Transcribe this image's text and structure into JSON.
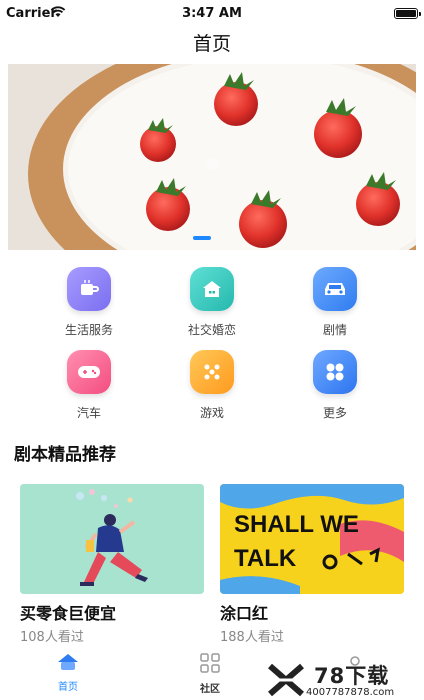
{
  "status": {
    "carrier": "Carrier",
    "time": "3:47 AM"
  },
  "nav": {
    "title": "首页"
  },
  "banner": {
    "image": "strawberry-toast-photo"
  },
  "grid": [
    {
      "label": "生活服务",
      "icon": "cup-icon",
      "color": "#8f86f5"
    },
    {
      "label": "社交婚恋",
      "icon": "house-icon",
      "color": "#3ccfc4"
    },
    {
      "label": "剧情",
      "icon": "car-icon",
      "color": "#4a93ff"
    },
    {
      "label": "汽车",
      "icon": "gamepad-icon",
      "color": "#ff6f98"
    },
    {
      "label": "游戏",
      "icon": "dots-icon",
      "color": "#ffb02e"
    },
    {
      "label": "更多",
      "icon": "more-icon",
      "color": "#3f8dff"
    }
  ],
  "section": {
    "title": "剧本精品推荐"
  },
  "cards": [
    {
      "title": "买零食巨便宜",
      "views": "108人看过"
    },
    {
      "title": "涂口红",
      "views": "188人看过",
      "art_text": "SHALL WE TALK"
    }
  ],
  "tabs": [
    {
      "label": "首页",
      "icon": "home-icon",
      "active": true
    },
    {
      "label": "社区",
      "icon": "grid-icon",
      "active": false
    }
  ],
  "watermark": {
    "big": "78下载",
    "small": "4007787878.com"
  },
  "colors": {
    "accent": "#1e88ff",
    "text": "#222222",
    "muted": "#888888"
  }
}
